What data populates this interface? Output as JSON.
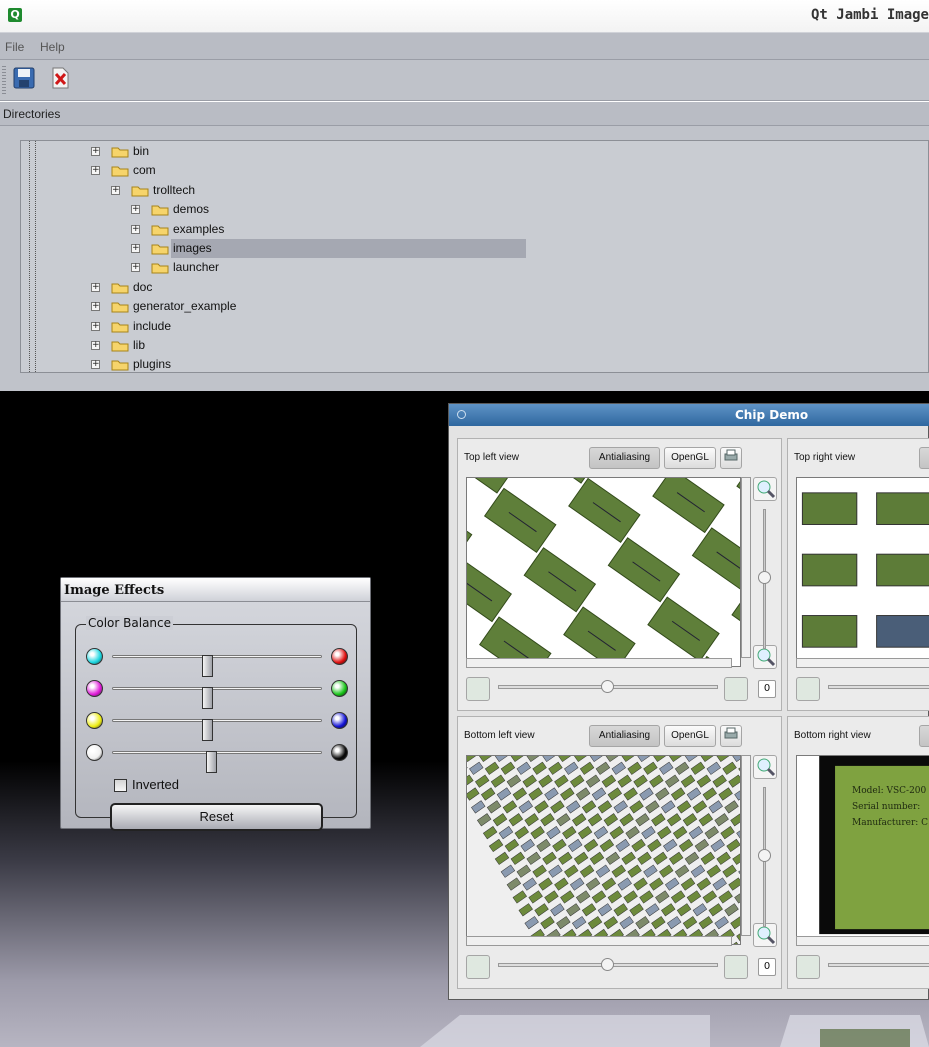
{
  "window": {
    "title": "Qt Jambi Image",
    "icon": "qt-logo-icon"
  },
  "menu": [
    "File",
    "Help"
  ],
  "toolbar": {
    "save_icon": "floppy-save-icon",
    "close_icon": "close-document-icon"
  },
  "dock": {
    "title": "Directories"
  },
  "tree": [
    {
      "label": "bin",
      "depth": 0
    },
    {
      "label": "com",
      "depth": 0
    },
    {
      "label": "trolltech",
      "depth": 1
    },
    {
      "label": "demos",
      "depth": 2
    },
    {
      "label": "examples",
      "depth": 2
    },
    {
      "label": "images",
      "depth": 2,
      "selected": true
    },
    {
      "label": "launcher",
      "depth": 2
    },
    {
      "label": "doc",
      "depth": 0
    },
    {
      "label": "generator_example",
      "depth": 0
    },
    {
      "label": "include",
      "depth": 0
    },
    {
      "label": "lib",
      "depth": 0
    },
    {
      "label": "plugins",
      "depth": 0
    }
  ],
  "effects": {
    "title": "Image Effects",
    "group": "Color Balance",
    "rows": [
      {
        "left_color": "#19d6e0",
        "right_color": "#e01010",
        "value": 0.45
      },
      {
        "left_color": "#e019d8",
        "right_color": "#17c417",
        "value": 0.45
      },
      {
        "left_color": "#eded12",
        "right_color": "#1212d6",
        "value": 0.45
      },
      {
        "left_color": "#f0f0f0",
        "right_color": "#080808",
        "value": 0.47
      }
    ],
    "inverted_label": "Inverted",
    "inverted": false,
    "reset_label": "Reset"
  },
  "chip": {
    "title": "Chip Demo",
    "views": [
      {
        "label": "Top left view",
        "antialias": "Antialiasing",
        "opengl": "OpenGL",
        "rotation": "0"
      },
      {
        "label": "Top right view",
        "antialias": "An",
        "opengl": "",
        "rotation": ""
      },
      {
        "label": "Bottom left view",
        "antialias": "Antialiasing",
        "opengl": "OpenGL",
        "rotation": "0"
      },
      {
        "label": "Bottom right view",
        "antialias": "An",
        "opengl": "",
        "rotation": ""
      }
    ],
    "chip_info": [
      "Model: VSC-200",
      "Serial number: ",
      "Manufacturer: C"
    ]
  },
  "colors": {
    "accent": "#2f679f",
    "selection": "#a5a8b2",
    "chip_green": "#6a8a40"
  }
}
